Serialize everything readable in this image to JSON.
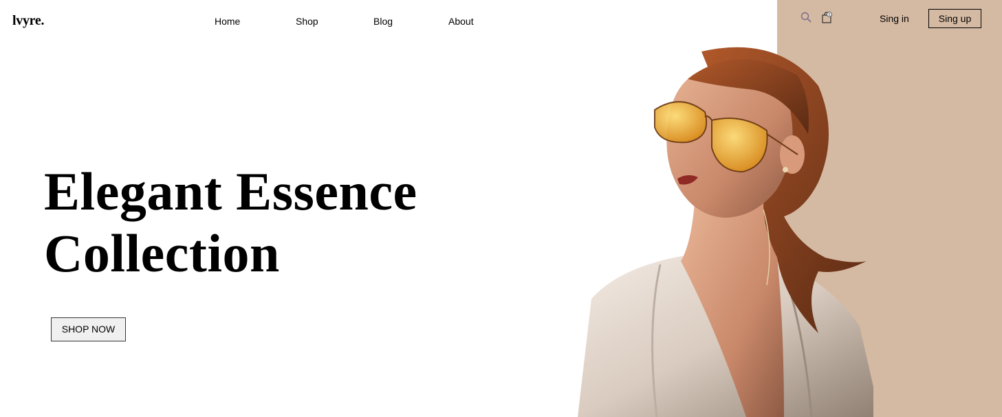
{
  "brand": {
    "logo": "lvyre."
  },
  "nav": {
    "items": [
      "Home",
      "Shop",
      "Blog",
      "About"
    ]
  },
  "header": {
    "signin_label": "Sing in",
    "signup_label": "Sing up",
    "cart_count": "0"
  },
  "hero": {
    "title_line1": "Elegant Essence",
    "title_line2": "Collection",
    "cta_label": "SHOP NOW"
  },
  "colors": {
    "accent_panel": "#d5baa3",
    "background": "#ffffff",
    "text": "#000000",
    "search_icon": "#7b6a8a"
  },
  "icons": [
    "search-icon",
    "shopping-bag-icon"
  ],
  "image": {
    "subject": "model-wearing-amber-aviator-sunglasses"
  }
}
